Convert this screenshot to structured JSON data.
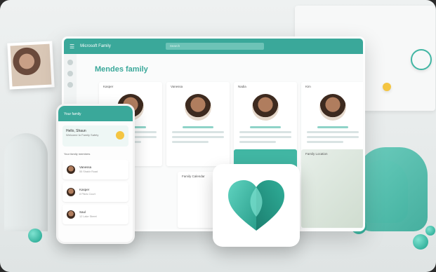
{
  "tablet": {
    "app_name": "Microsoft Family",
    "search_placeholder": "Search",
    "family_title": "Mendes family",
    "members": [
      {
        "name": "Kasper"
      },
      {
        "name": "Vanessa"
      },
      {
        "name": "Nadia"
      },
      {
        "name": "Kim"
      }
    ],
    "family_calendar": "Family Calendar",
    "family_location": "Family Location"
  },
  "phone": {
    "title": "Your family",
    "greeting": "Hello, Shaun",
    "greeting_sub": "Welcome to Family Safety",
    "section": "Your family members",
    "members": [
      {
        "name": "Vanessa",
        "detail": "55 Shakir Road"
      },
      {
        "name": "Kasper",
        "detail": "8 Pikes Court"
      },
      {
        "name": "Saul",
        "detail": "12 Lake Street"
      }
    ]
  },
  "colors": {
    "brand_teal": "#3aa89a",
    "accent_teal": "#41b6a3",
    "light_teal": "#8fd3c8"
  },
  "icons": {
    "menu": "hamburger-icon",
    "logo": "heart-logo-icon"
  }
}
